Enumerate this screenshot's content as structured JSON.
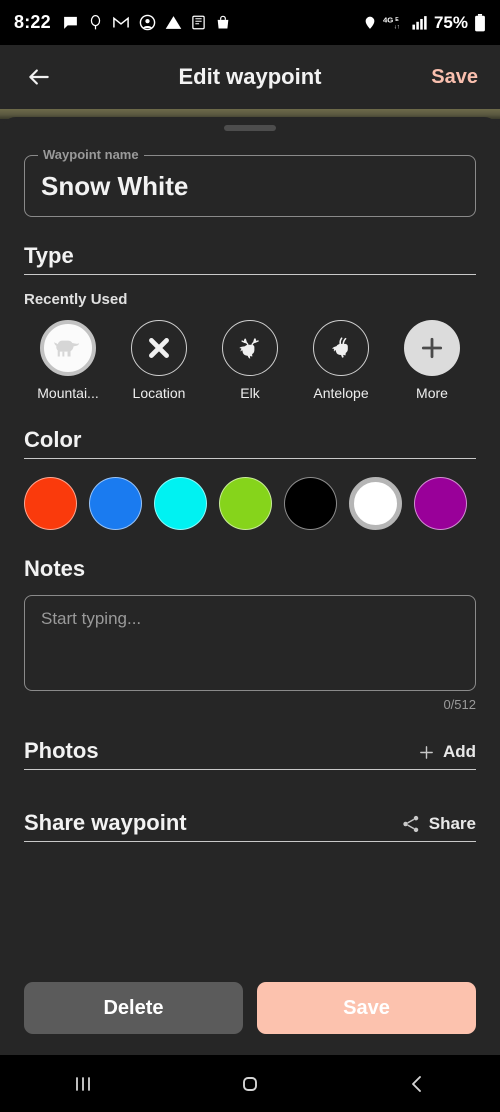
{
  "statusbar": {
    "time": "8:22",
    "left_icons": [
      "message-icon",
      "balloon-icon",
      "gmail-icon",
      "face-icon",
      "warning-icon",
      "nfl-icon",
      "bag-icon"
    ],
    "right_icons": [
      "location-icon",
      "network-4glte-icon",
      "signal-bars-icon"
    ],
    "battery_percent": "75%"
  },
  "appbar": {
    "back_label": "back-arrow",
    "title": "Edit waypoint",
    "save_label": "Save",
    "save_color": "#f9bfae"
  },
  "name_field": {
    "legend": "Waypoint name",
    "value": "Snow White",
    "placeholder": "Waypoint name"
  },
  "type": {
    "title": "Type",
    "subtitle": "Recently Used",
    "items": [
      {
        "label": "Mountai...",
        "icon": "mountain-goat-icon",
        "state": "selected"
      },
      {
        "label": "Location",
        "icon": "x-mark-icon",
        "state": "normal"
      },
      {
        "label": "Elk",
        "icon": "elk-icon",
        "state": "normal"
      },
      {
        "label": "Antelope",
        "icon": "antelope-icon",
        "state": "normal"
      },
      {
        "label": "More",
        "icon": "plus-icon",
        "state": "filled"
      }
    ]
  },
  "color": {
    "title": "Color",
    "swatches": [
      {
        "name": "red",
        "hex": "#FA3A0C",
        "selected": false
      },
      {
        "name": "blue",
        "hex": "#1A7BF0",
        "selected": false
      },
      {
        "name": "cyan",
        "hex": "#00F2F2",
        "selected": false
      },
      {
        "name": "green",
        "hex": "#86D41B",
        "selected": false
      },
      {
        "name": "black",
        "hex": "#000000",
        "selected": false
      },
      {
        "name": "white",
        "hex": "#FFFFFF",
        "selected": true
      },
      {
        "name": "purple",
        "hex": "#990099",
        "selected": false
      }
    ]
  },
  "notes": {
    "title": "Notes",
    "placeholder": "Start typing...",
    "value": "",
    "counter": "0/512"
  },
  "photos": {
    "title": "Photos",
    "action_label": "Add",
    "action_icon": "plus-icon"
  },
  "share": {
    "title": "Share waypoint",
    "action_label": "Share",
    "action_icon": "share-icon"
  },
  "footer": {
    "delete_label": "Delete",
    "save_label": "Save"
  },
  "navbar": {
    "recents": "recents-icon",
    "home": "home-icon",
    "back": "back-icon"
  }
}
